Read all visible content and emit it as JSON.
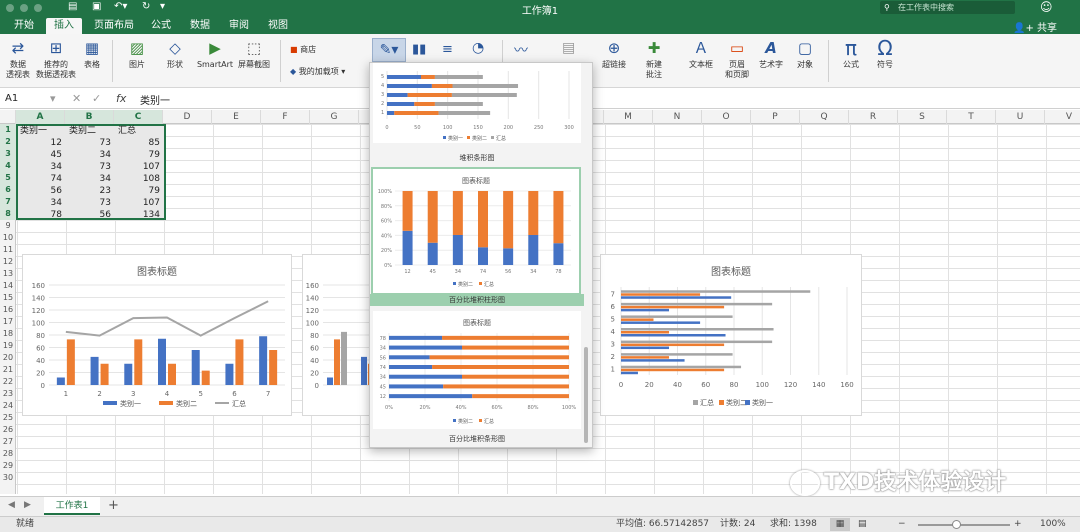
{
  "title_bar": {
    "document_title": "工作簿1",
    "search_placeholder": "在工作表中搜索"
  },
  "menu": {
    "tabs": [
      "开始",
      "插入",
      "页面布局",
      "公式",
      "数据",
      "审阅",
      "视图"
    ],
    "active_tab": "插入",
    "share_label": "共享"
  },
  "ribbon": {
    "pivot_table": "数据\n透视表",
    "recommended_pivot": "推荐的\n数据透视表",
    "table": "表格",
    "pictures": "图片",
    "shapes": "形状",
    "smartart": "SmartArt",
    "screenshot": "屏幕截图",
    "store": "商店",
    "my_addins": "我的加载项",
    "hyperlink": "超链接",
    "new_comment": "新建\n批注",
    "textbox": "文本框",
    "header_footer": "页眉\n和页脚",
    "wordart": "艺术字",
    "object": "对象",
    "equation": "公式",
    "symbol": "符号"
  },
  "formula_bar": {
    "name_box": "A1",
    "fx": "fx",
    "content": "类别一"
  },
  "columns": [
    "A",
    "B",
    "C",
    "D",
    "E",
    "F",
    "G",
    "H",
    "I",
    "J",
    "K",
    "L",
    "M",
    "N",
    "O",
    "P",
    "Q",
    "R",
    "S",
    "T",
    "U",
    "V"
  ],
  "rows": [
    "1",
    "2",
    "3",
    "4",
    "5",
    "6",
    "7",
    "8",
    "9",
    "10",
    "11",
    "12",
    "13",
    "14",
    "15",
    "16",
    "17",
    "18",
    "19",
    "20",
    "21",
    "22",
    "23",
    "24",
    "25",
    "26",
    "27",
    "28",
    "29",
    "30"
  ],
  "table": {
    "headers": [
      "类别一",
      "类别二",
      "汇总"
    ],
    "rows": [
      [
        "12",
        "73",
        "85"
      ],
      [
        "45",
        "34",
        "79"
      ],
      [
        "34",
        "73",
        "107"
      ],
      [
        "74",
        "34",
        "108"
      ],
      [
        "56",
        "23",
        "79"
      ],
      [
        "34",
        "73",
        "107"
      ],
      [
        "78",
        "56",
        "134"
      ]
    ]
  },
  "chart_data": [
    {
      "type": "bar",
      "title": "图表标题",
      "categories": [
        "1",
        "2",
        "3",
        "4",
        "5",
        "6",
        "7"
      ],
      "series": [
        {
          "name": "类别一",
          "values": [
            12,
            45,
            34,
            74,
            56,
            34,
            78
          ],
          "kind": "bar",
          "color": "#4472c4"
        },
        {
          "name": "类别二",
          "values": [
            73,
            34,
            73,
            34,
            23,
            73,
            56
          ],
          "kind": "bar",
          "color": "#ed7d31"
        },
        {
          "name": "汇总",
          "values": [
            85,
            79,
            107,
            108,
            79,
            107,
            134
          ],
          "kind": "line",
          "color": "#a5a5a5"
        }
      ],
      "yticks": [
        "0",
        "20",
        "40",
        "60",
        "80",
        "100",
        "120",
        "140",
        "160"
      ],
      "ylim": [
        0,
        160
      ],
      "legend": "bottom"
    },
    {
      "type": "bar",
      "orientation": "horizontal",
      "title": "图表标题",
      "categories": [
        "1",
        "2",
        "3",
        "4",
        "5",
        "6",
        "7"
      ],
      "series": [
        {
          "name": "汇总",
          "values": [
            85,
            79,
            107,
            108,
            79,
            107,
            134
          ],
          "color": "#a5a5a5"
        },
        {
          "name": "类别二",
          "values": [
            73,
            34,
            73,
            34,
            23,
            73,
            56
          ],
          "color": "#ed7d31"
        },
        {
          "name": "类别一",
          "values": [
            12,
            45,
            34,
            74,
            56,
            34,
            78
          ],
          "color": "#4472c4"
        }
      ],
      "xticks": [
        "0",
        "20",
        "40",
        "60",
        "80",
        "100",
        "120",
        "140",
        "160"
      ],
      "xlim": [
        0,
        160
      ],
      "legend": "bottom"
    }
  ],
  "partial_chart": {
    "yticks": [
      "0",
      "20",
      "40",
      "60",
      "80",
      "100",
      "120",
      "140",
      "160"
    ]
  },
  "gallery": {
    "items": [
      {
        "label": "堆积条形图",
        "title": "",
        "ticks": [
          "0",
          "50",
          "100",
          "150",
          "200",
          "250",
          "300"
        ],
        "legend": [
          "类别一",
          "类别二",
          "汇总"
        ]
      },
      {
        "label": "百分比堆积柱形图",
        "title": "图表标题",
        "ticks": [
          "0%",
          "20%",
          "40%",
          "60%",
          "80%",
          "100%"
        ],
        "categories": [
          "12",
          "45",
          "34",
          "74",
          "56",
          "34",
          "78"
        ],
        "legend": [
          "类别二",
          "汇总"
        ]
      },
      {
        "label": "百分比堆积条形图",
        "title": "图表标题",
        "ticks": [
          "0%",
          "20%",
          "40%",
          "60%",
          "80%",
          "100%"
        ],
        "categories": [
          "12",
          "45",
          "34",
          "74",
          "56",
          "34",
          "78"
        ],
        "legend": [
          "类别二",
          "汇总"
        ]
      }
    ]
  },
  "sheet_tabs": {
    "active": "工作表1",
    "add": "+"
  },
  "status": {
    "ready": "就绪",
    "average": "平均值: 66.57142857",
    "count": "计数: 24",
    "sum": "求和: 1398",
    "zoom": "100%"
  },
  "watermark": "TXD技术体验设计",
  "colors": {
    "excel_green": "#217346",
    "blue": "#4472c4",
    "orange": "#ed7d31",
    "gray": "#a5a5a5"
  }
}
